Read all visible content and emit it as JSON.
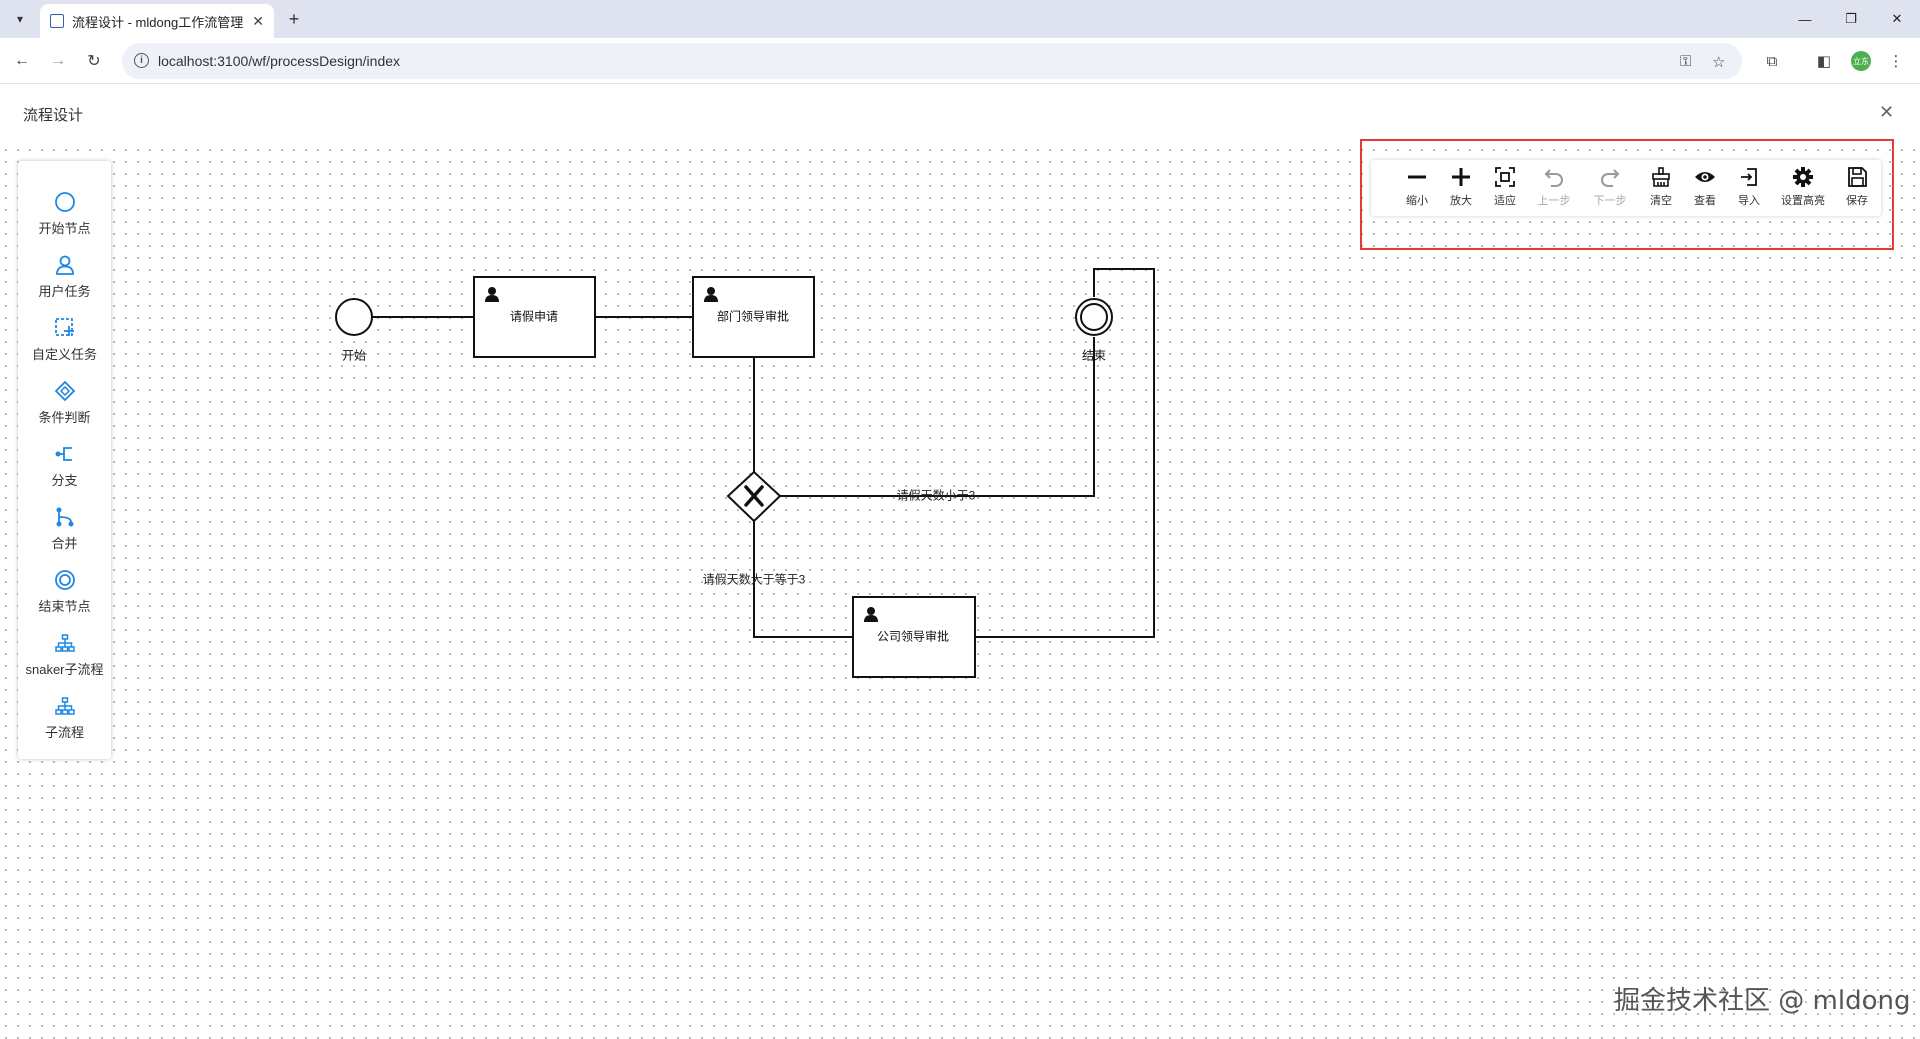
{
  "browser": {
    "tab_title": "流程设计 - mldong工作流管理",
    "url": "localhost:3100/wf/processDesign/index",
    "avatar_text": "立东"
  },
  "page": {
    "title": "流程设计"
  },
  "palette": {
    "items": [
      {
        "label": "开始节点",
        "icon": "circle-icon"
      },
      {
        "label": "用户任务",
        "icon": "user-icon"
      },
      {
        "label": "自定义任务",
        "icon": "custom-task-icon"
      },
      {
        "label": "条件判断",
        "icon": "diamond-icon"
      },
      {
        "label": "分支",
        "icon": "fork-icon"
      },
      {
        "label": "合并",
        "icon": "join-icon"
      },
      {
        "label": "结束节点",
        "icon": "double-circle-icon"
      },
      {
        "label": "snaker子流程",
        "icon": "subprocess-icon"
      },
      {
        "label": "子流程",
        "icon": "subprocess-icon"
      }
    ]
  },
  "toolbar": {
    "items": [
      {
        "label": "缩小",
        "icon": "zoom-out-icon",
        "disabled": false
      },
      {
        "label": "放大",
        "icon": "zoom-in-icon",
        "disabled": false
      },
      {
        "label": "适应",
        "icon": "fit-icon",
        "disabled": false
      },
      {
        "label": "上一步",
        "icon": "undo-icon",
        "disabled": true
      },
      {
        "label": "下一步",
        "icon": "redo-icon",
        "disabled": true
      },
      {
        "label": "清空",
        "icon": "clear-icon",
        "disabled": false
      },
      {
        "label": "查看",
        "icon": "eye-icon",
        "disabled": false
      },
      {
        "label": "导入",
        "icon": "import-icon",
        "disabled": false
      },
      {
        "label": "设置高亮",
        "icon": "gear-icon",
        "disabled": false
      },
      {
        "label": "保存",
        "icon": "save-icon",
        "disabled": false
      }
    ]
  },
  "diagram": {
    "nodes": {
      "start": "开始",
      "apply": "请假申请",
      "dept": "部门领导审批",
      "company": "公司领导审批",
      "end": "结束"
    },
    "edges": {
      "less_than_3": "请假天数小于3",
      "gte_3": "请假天数大于等于3"
    }
  },
  "watermark": "掘金技术社区 @ mldong"
}
